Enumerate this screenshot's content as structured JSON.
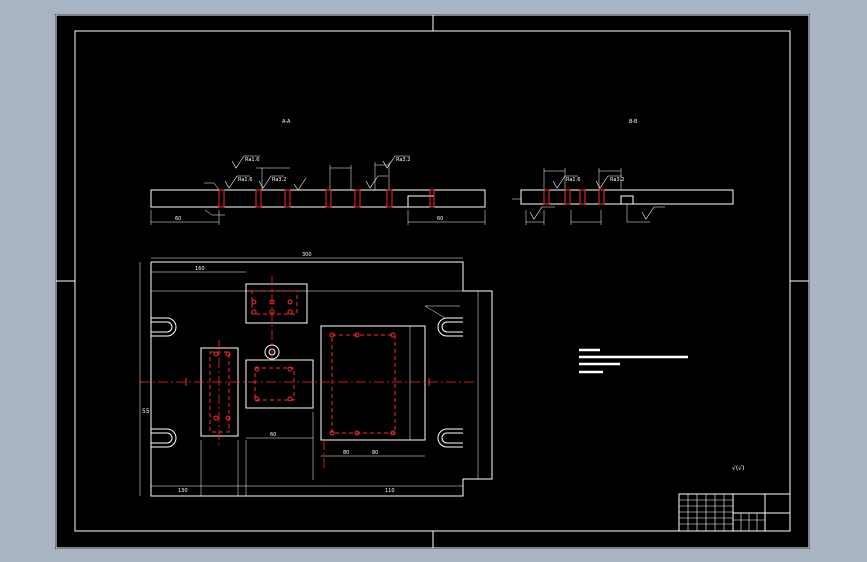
{
  "colors": {
    "background": "#a9b4c3",
    "sheet": "#000000",
    "line": "#ffffff",
    "hidden_line": "#ff2a2a",
    "hatch": "#ffffff"
  },
  "drawing": {
    "section_left_label": "A-A",
    "section_right_label": "B-B",
    "finish_symbol": "√(√)",
    "title_block_name": "",
    "title_block_part": "",
    "roughness_labels": [
      "Ra1.6",
      "Ra1.6",
      "Ra3.2",
      "Ra3.2",
      "Ra1.6",
      "Ra3.2"
    ],
    "dims_plan": [
      "300",
      "160",
      "55",
      "130",
      "110",
      "60",
      "80",
      "80",
      "130"
    ],
    "tech_req_title": "",
    "tech_req_lines": [
      "",
      "",
      "",
      ""
    ]
  }
}
